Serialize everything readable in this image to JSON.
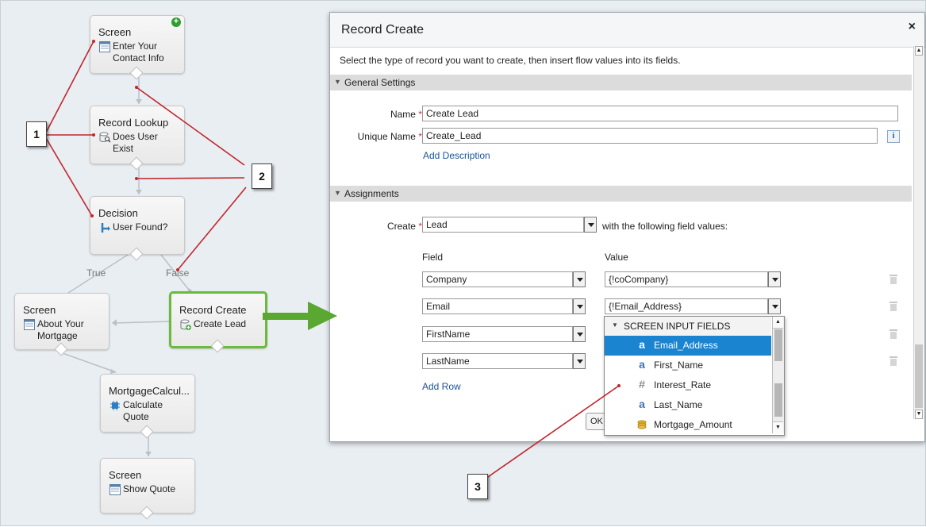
{
  "canvas": {
    "nodes": {
      "screen1": {
        "type": "Screen",
        "name_lines": [
          "Enter Your",
          "Contact Info"
        ]
      },
      "lookup": {
        "type": "Record Lookup",
        "name_lines": [
          "Does User",
          "Exist"
        ]
      },
      "decision": {
        "type": "Decision",
        "name_lines": [
          "User Found?"
        ]
      },
      "screen2": {
        "type": "Screen",
        "name_lines": [
          "About Your",
          "Mortgage"
        ]
      },
      "create": {
        "type": "Record Create",
        "name_lines": [
          "Create Lead"
        ]
      },
      "calc": {
        "type": "MortgageCalcul...",
        "name_lines": [
          "Calculate",
          "Quote"
        ]
      },
      "screen3": {
        "type": "Screen",
        "name_lines": [
          "Show Quote"
        ]
      }
    },
    "connector_labels": {
      "true": "True",
      "false": "False"
    },
    "callouts": {
      "one": "1",
      "two": "2",
      "three": "3"
    },
    "add_badge": "+"
  },
  "dialog": {
    "title": "Record Create",
    "close": "×",
    "intro": "Select the type of record you want to create, then insert flow values into its fields.",
    "general_settings": {
      "header": "General Settings",
      "name_label": "Name",
      "name_value": "Create Lead",
      "unique_label": "Unique Name",
      "unique_value": "Create_Lead",
      "add_description": "Add Description",
      "info": "i",
      "required": "*"
    },
    "assignments": {
      "header": "Assignments",
      "create_label": "Create",
      "create_value": "Lead",
      "with_text": "with the following field values:",
      "field_header": "Field",
      "value_header": "Value",
      "rows": [
        {
          "field": "Company",
          "value": "{!coCompany}"
        },
        {
          "field": "Email",
          "value": "{!Email_Address}"
        },
        {
          "field": "FirstName",
          "value": ""
        },
        {
          "field": "LastName",
          "value": ""
        }
      ],
      "add_row": "Add Row"
    },
    "ok_label": "OK"
  },
  "dropdown": {
    "header": "SCREEN INPUT FIELDS",
    "options": [
      {
        "label": "Email_Address",
        "icon": "text-icon",
        "glyph": "a",
        "selected": true
      },
      {
        "label": "First_Name",
        "icon": "text-icon",
        "glyph": "a",
        "selected": false
      },
      {
        "label": "Interest_Rate",
        "icon": "number-icon",
        "glyph": "#",
        "selected": false
      },
      {
        "label": "Last_Name",
        "icon": "text-icon",
        "glyph": "a",
        "selected": false
      },
      {
        "label": "Mortgage_Amount",
        "icon": "currency-icon",
        "glyph": "$",
        "selected": false
      }
    ]
  },
  "colors": {
    "callout_line": "#c0272d",
    "selection_green": "#6bbb3b",
    "arrow_green": "#5aa831",
    "link_blue": "#1b5297",
    "dropdown_selected": "#1a84d1"
  }
}
